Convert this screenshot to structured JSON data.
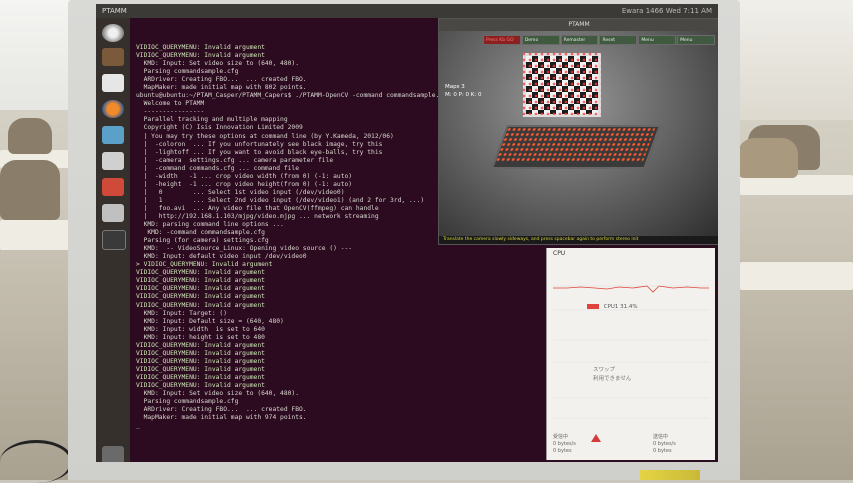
{
  "topbar": {
    "title": "PTAMM",
    "status": "Ewara 1466 Wed 7:11 AM"
  },
  "terminal": {
    "lines": [
      "VIDIOC_QUERYMENU: Invalid argument",
      "VIDIOC_QUERYMENU: Invalid argument",
      "  KMD: Input: Set video size to (640, 480).",
      "  Parsing commandsample.cfg",
      "  ARDriver: Creating FBO...  ... created FBO.",
      "  MapMaker: made initial map with 802 points.",
      "",
      "ubuntu@ubuntu:~/PTAM_Casper/PTAMM_Capers$ ./PTAMM-OpenCV -command commandsample.cfg",
      "  Welcome to PTAMM",
      "  ----------------",
      "  Parallel tracking and multiple mapping",
      "  Copyright (C) Isis Innovation Limited 2009",
      "",
      "  | You may try these options at command line (by Y.Kameda, 2012/06)",
      "  |  -coloron  ... If you unfortunately see black image, try this",
      "  |  -lightoff ... If you want to avoid black eye-balls, try this",
      "  |  -camera  settings.cfg ... camera parameter file",
      "  |  -command commands.cfg ... command file",
      "  |  -width   -1 ... crop video width (from 0) (-1: auto)",
      "  |  -height  -1 ... crop video height(from 0) (-1: auto)",
      "  |   0        ... Select 1st video input (/dev/video0)",
      "  |   1        ... Select 2nd video input (/dev/video1) (and 2 for 3rd, ...)",
      "  |   foo.avi  ... Any video file that OpenCV(ffmpeg) can handle",
      "  |   http://192.168.1.103/mjpg/video.mjpg ... network streaming",
      "",
      "  KMD: parsing command line options ...",
      "   KMD: -command commandsample.cfg",
      "  Parsing (for camera) settings.cfg",
      "  KMD:  -- VideoSource_Linux: Opening video source () ---",
      "  KMD: Input: default video input /dev/video0",
      "> VIDIOC_QUERYMENU: Invalid argument",
      "VIDIOC_QUERYMENU: Invalid argument",
      "VIDIOC_QUERYMENU: Invalid argument",
      "VIDIOC_QUERYMENU: Invalid argument",
      "VIDIOC_QUERYMENU: Invalid argument",
      "VIDIOC_QUERYMENU: Invalid argument",
      "  KMD: Input: Target: ()",
      "  KMD: Input: Default size = (640, 480)",
      "  KMD: Input: width  is set to 640",
      "  KMD: Input: height is set to 480",
      "VIDIOC_QUERYMENU: Invalid argument",
      "VIDIOC_QUERYMENU: Invalid argument",
      "VIDIOC_QUERYMENU: Invalid argument",
      "VIDIOC_QUERYMENU: Invalid argument",
      "VIDIOC_QUERYMENU: Invalid argument",
      "VIDIOC_QUERYMENU: Invalid argument",
      "  KMD: Input: Set video size to (640, 480).",
      "  Parsing commandsample.cfg",
      "  ARDriver: Creating FBO...  ... created FBO.",
      "  MapMaker: made initial map with 974 points.",
      "_"
    ]
  },
  "ptamm_window": {
    "title": "PTAMM",
    "menu": [
      "Press Kb GO",
      "Demo",
      "Remaster",
      "Reset",
      "Menu",
      "Menu"
    ],
    "maps_label": "Maps 3",
    "maps_sub": "M: 0  P: 0  K: 0",
    "tracking_message": "Translate the camera slowly sideways, and press spacebar again to perform stereo init"
  },
  "system_monitor": {
    "header": "CPU",
    "cpu_legend": "CPU1 31.4%",
    "swap_line1": "スワップ",
    "swap_line2": "利用できません",
    "net_recv_label": "受信中",
    "net_recv_value": "0 bytes/s",
    "net_recv_total": "0 bytes",
    "net_send_label": "送信中",
    "net_send_value": "0 bytes/s",
    "net_send_total": "0 bytes"
  }
}
